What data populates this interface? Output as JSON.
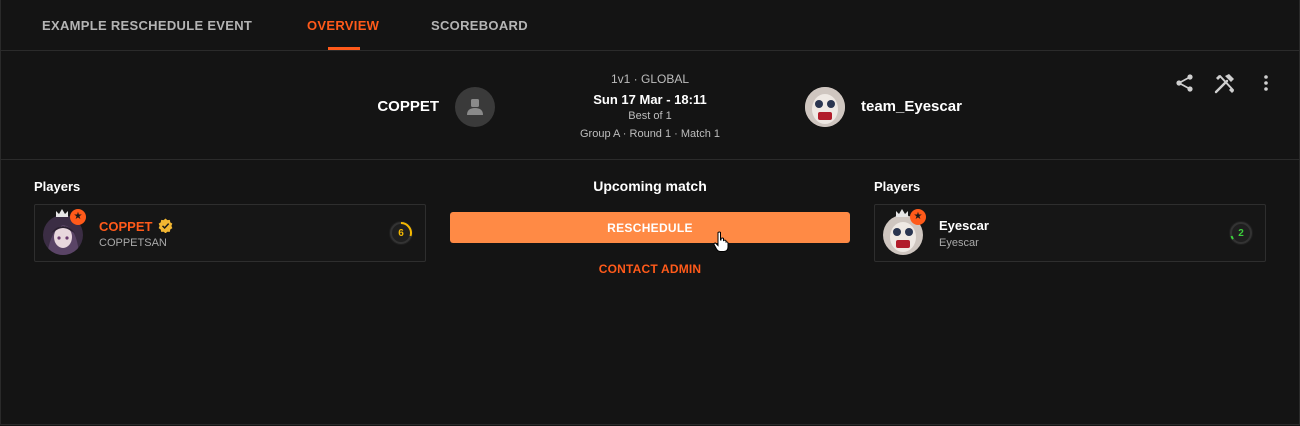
{
  "tabs": [
    {
      "label": "EXAMPLE RESCHEDULE EVENT"
    },
    {
      "label": "OVERVIEW",
      "active": true
    },
    {
      "label": "SCOREBOARD"
    }
  ],
  "match": {
    "team_left": "COPPET",
    "team_right": "team_Eyescar",
    "mode": "1v1 · GLOBAL",
    "date": "Sun 17 Mar - 18:11",
    "best_of": "Best of 1",
    "round": "Group A · Round 1 · Match 1"
  },
  "header_icons": [
    "share-icon",
    "tools-icon",
    "more-vertical-icon"
  ],
  "left_panel": {
    "title": "Players",
    "player": {
      "name": "COPPET",
      "nickname": "COPPETSAN",
      "level": "6",
      "verified": true
    }
  },
  "right_panel": {
    "title": "Players",
    "player": {
      "name": "Eyescar",
      "nickname": "Eyescar",
      "level": "2"
    }
  },
  "center": {
    "upcoming": "Upcoming match",
    "reschedule": "RESCHEDULE",
    "contact": "CONTACT ADMIN"
  },
  "colors": {
    "accent": "#ff5a1a",
    "button": "#ff8a45",
    "background": "#141414",
    "level_6": "#f5b800",
    "level_2": "#3ccf3c"
  }
}
